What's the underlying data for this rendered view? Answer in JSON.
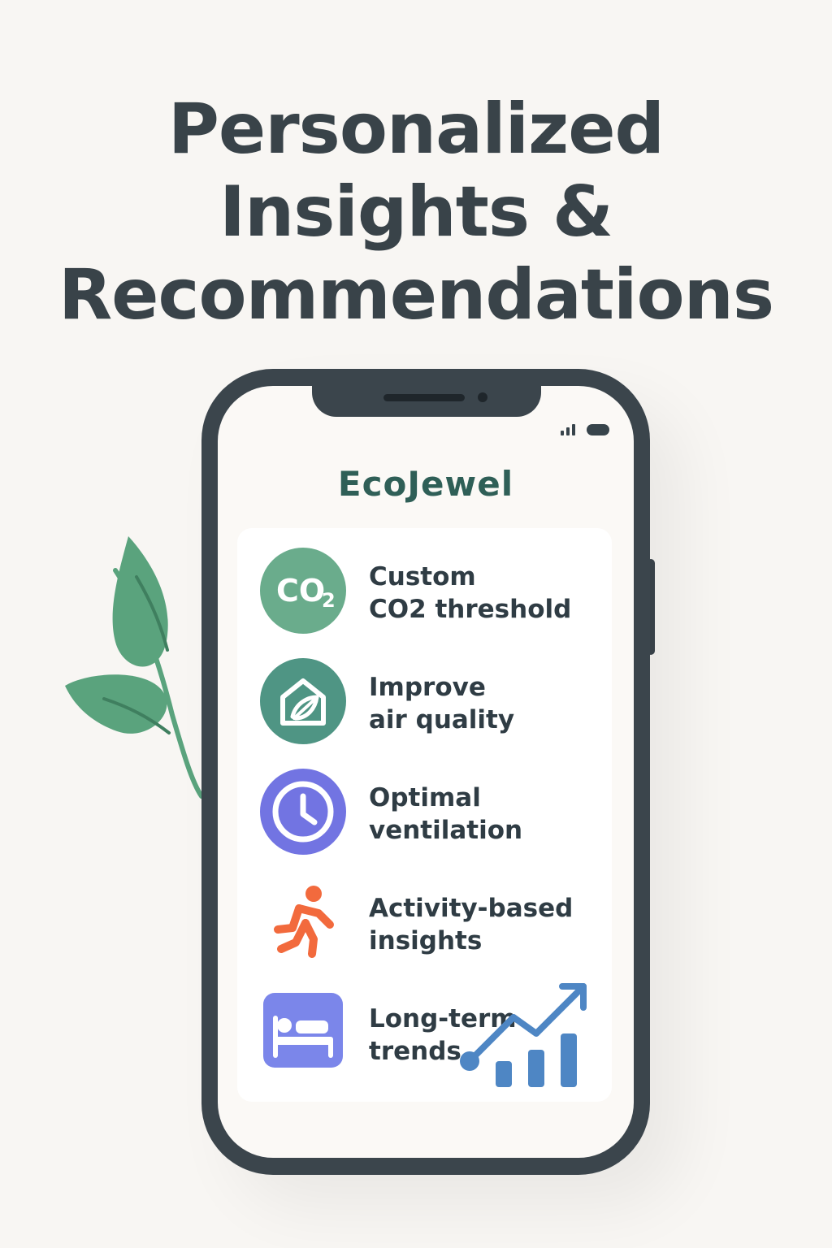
{
  "headline": {
    "line1": "Personalized",
    "line2": "Insights &",
    "line3": "Recommendations"
  },
  "app": {
    "name": "EcoJewel",
    "accent": "#2f5f57",
    "screen_bg": "#fbf9f6",
    "phone_color": "#3b454c"
  },
  "items": [
    {
      "icon": "co2-icon",
      "icon_text": "CO2",
      "line1": "Custom",
      "line2": "CO2 threshold",
      "color": "#6aac8c"
    },
    {
      "icon": "house-leaf-icon",
      "line1": "Improve",
      "line2": "air quality",
      "color": "#4f9584"
    },
    {
      "icon": "clock-icon",
      "line1": "Optimal",
      "line2": "ventilation",
      "color": "#7274e2"
    },
    {
      "icon": "running-person-icon",
      "line1": "Activity-based",
      "line2": "insights",
      "color": "#f26a3d"
    },
    {
      "icon": "bed-icon",
      "line1": "Long-term",
      "line2": "trends",
      "color": "#7b86ea"
    }
  ],
  "decorations": {
    "leaf_color": "#5aa37d",
    "trend_chart_color": "#4e86c4"
  }
}
